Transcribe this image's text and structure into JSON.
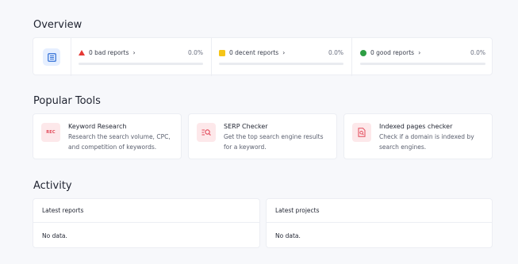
{
  "overview": {
    "title": "Overview",
    "icon": "report-list-icon",
    "items": [
      {
        "label": "0 bad reports",
        "percent": "0.0%",
        "marker": "triangle",
        "color": "#e53935",
        "progress": 0
      },
      {
        "label": "0 decent reports",
        "percent": "0.0%",
        "marker": "square",
        "color": "#f5c518",
        "progress": 0
      },
      {
        "label": "0 good reports",
        "percent": "0.0%",
        "marker": "circle",
        "color": "#2e9e44",
        "progress": 0
      }
    ]
  },
  "popular_tools": {
    "title": "Popular Tools",
    "accent": "#e24a5a",
    "items": [
      {
        "title": "Keyword Research",
        "description_lines": [
          "Research the search volume, CPC,",
          "and competition of keywords."
        ],
        "icon": "keyword-icon",
        "icon_text": "REC"
      },
      {
        "title": "SERP Checker",
        "description_lines": [
          "Get the top search engine results",
          "for a keyword."
        ],
        "icon": "serp-search-icon"
      },
      {
        "title": "Indexed pages checker",
        "description_lines": [
          "Check if a domain is indexed by",
          "search engines."
        ],
        "icon": "indexed-page-icon"
      }
    ]
  },
  "activity": {
    "title": "Activity",
    "panels": [
      {
        "title": "Latest reports",
        "body": "No data."
      },
      {
        "title": "Latest projects",
        "body": "No data."
      }
    ]
  }
}
